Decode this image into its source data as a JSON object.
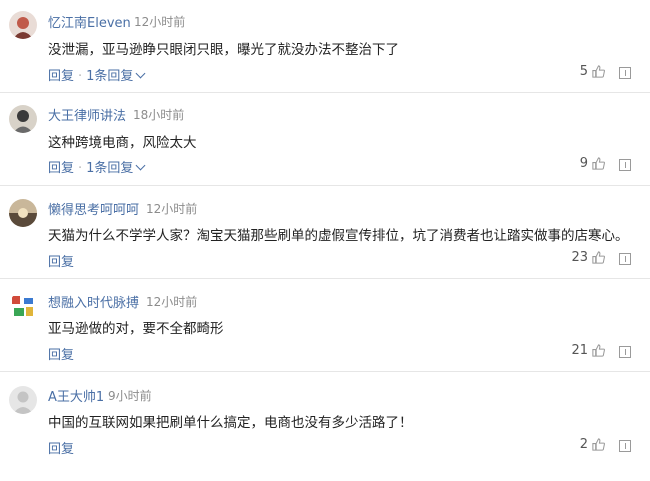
{
  "comments": [
    {
      "user": "忆江南Eleven",
      "time": "12小时前",
      "text": "没泄漏，亚马逊睁只眼闭只眼，曝光了就没办法不整治下了",
      "reply": "回复",
      "replies": "1条回复",
      "likes": "5"
    },
    {
      "user": "大王律师讲法",
      "time": "18小时前",
      "text": "这种跨境电商，风险太大",
      "reply": "回复",
      "replies": "1条回复",
      "likes": "9"
    },
    {
      "user": "懒得思考呵呵呵",
      "time": "12小时前",
      "text": "天猫为什么不学学人家？淘宝天猫那些刷单的虚假宣传排位，坑了消费者也让踏实做事的店寒心。",
      "reply": "回复",
      "likes": "23"
    },
    {
      "user": "想融入时代脉搏",
      "time": "12小时前",
      "text": "亚马逊做的对，要不全都畸形",
      "reply": "回复",
      "likes": "21"
    },
    {
      "user": "A王大帅1",
      "time": "9小时前",
      "text": "中国的互联网如果把刷单什么搞定，电商也没有多少活路了！",
      "reply": "回复",
      "likes": "2"
    }
  ],
  "colors": {
    "name": "#4a6fa5",
    "time": "#8c8c8c",
    "divider": "#e6e6e6"
  },
  "icons": {
    "like": "thumbs-up-icon",
    "report": "report-icon"
  }
}
